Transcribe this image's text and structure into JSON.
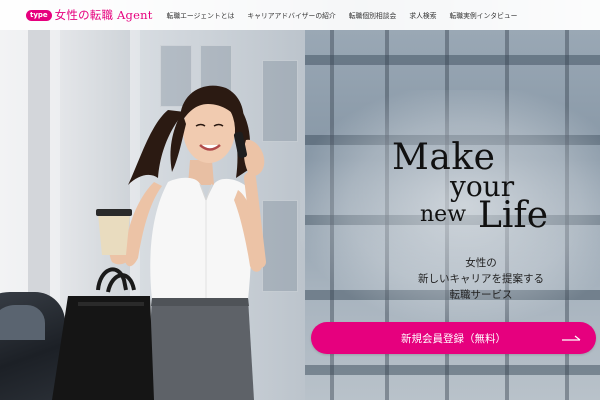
{
  "header": {
    "logo_badge": "type",
    "logo_text": "女性の転職 Agent",
    "nav": [
      "転職エージェントとは",
      "キャリアアドバイザーの紹介",
      "転職個別相談会",
      "求人検索",
      "転職実例インタビュー"
    ]
  },
  "hero": {
    "headline": {
      "make": "Make",
      "your": "your",
      "new": "new",
      "life": "Life"
    },
    "tagline": [
      "女性の",
      "新しいキャリアを提案する",
      "転職サービス"
    ],
    "cta_label": "新規会員登録（無料）"
  },
  "colors": {
    "brand": "#e6007e",
    "header_bg": "#ffffff",
    "text": "#111111"
  },
  "icons": {
    "cta": "arrow-right-icon"
  }
}
